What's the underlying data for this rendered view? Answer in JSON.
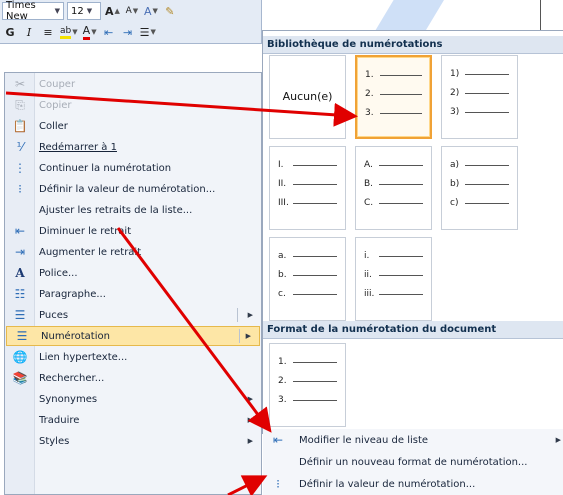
{
  "toolbar": {
    "font_name": "Times New",
    "font_size": "12",
    "bold_label": "G",
    "italic_label": "I",
    "grow_font_label": "A",
    "shrink_font_label": "A",
    "font_color_label": "A"
  },
  "context_menu": {
    "items": [
      {
        "label": "Couper",
        "icon": "scissors-icon",
        "enabled": false
      },
      {
        "label": "Copier",
        "icon": "copy-icon",
        "enabled": false
      },
      {
        "label": "Coller",
        "icon": "paste-icon",
        "enabled": true
      },
      {
        "label": "Redémarrer à 1",
        "icon": "restart-numbering-icon",
        "enabled": true
      },
      {
        "label": "Continuer la numérotation",
        "icon": "continue-numbering-icon",
        "enabled": true
      },
      {
        "label": "Définir la valeur de numérotation...",
        "icon": "set-value-icon",
        "enabled": true
      },
      {
        "label": "Ajuster les retraits de la liste...",
        "icon": "",
        "enabled": true
      },
      {
        "label": "Diminuer le retrait",
        "icon": "decrease-indent-icon",
        "enabled": true
      },
      {
        "label": "Augmenter le retrait",
        "icon": "increase-indent-icon",
        "enabled": true
      },
      {
        "label": "Police...",
        "icon": "font-icon",
        "enabled": true
      },
      {
        "label": "Paragraphe...",
        "icon": "paragraph-icon",
        "enabled": true
      },
      {
        "label": "Puces",
        "icon": "bullets-icon",
        "enabled": true,
        "submenu": true
      },
      {
        "label": "Numérotation",
        "icon": "numbering-icon",
        "enabled": true,
        "submenu": true,
        "highlighted": true
      },
      {
        "label": "Lien hypertexte...",
        "icon": "hyperlink-icon",
        "enabled": true
      },
      {
        "label": "Rechercher...",
        "icon": "research-icon",
        "enabled": true
      },
      {
        "label": "Synonymes",
        "icon": "",
        "enabled": true,
        "submenu": true
      },
      {
        "label": "Traduire",
        "icon": "",
        "enabled": true,
        "submenu": true
      },
      {
        "label": "Styles",
        "icon": "",
        "enabled": true,
        "submenu": true
      }
    ]
  },
  "numbering_panel": {
    "library_header": "Bibliothèque de numérotations",
    "none_label": "Aucun(e)",
    "library_formats": [
      [
        "1.",
        "2.",
        "3."
      ],
      [
        "1)",
        "2)",
        "3)"
      ],
      [
        "I.",
        "II.",
        "III."
      ],
      [
        "A.",
        "B.",
        "C."
      ],
      [
        "a)",
        "b)",
        "c)"
      ],
      [
        "a.",
        "b.",
        "c."
      ],
      [
        "i.",
        "ii.",
        "iii."
      ]
    ],
    "document_header": "Format de la numérotation du document",
    "document_formats": [
      [
        "1.",
        "2.",
        "3."
      ]
    ],
    "selected_format": "1."
  },
  "submenu_items": [
    {
      "label": "Modifier le niveau de liste",
      "icon": "list-level-icon",
      "submenu": true
    },
    {
      "label": "Définir un nouveau format de numérotation...",
      "icon": "",
      "submenu": false
    },
    {
      "label": "Définir la valeur de numérotation...",
      "icon": "set-value-icon",
      "submenu": false
    }
  ],
  "colors": {
    "highlight": "#fde6a6",
    "highlight_border": "#e6b94c",
    "selected_border": "#f0a236",
    "annotation_arrow": "#e00000",
    "header_bg": "#dee6f1"
  }
}
